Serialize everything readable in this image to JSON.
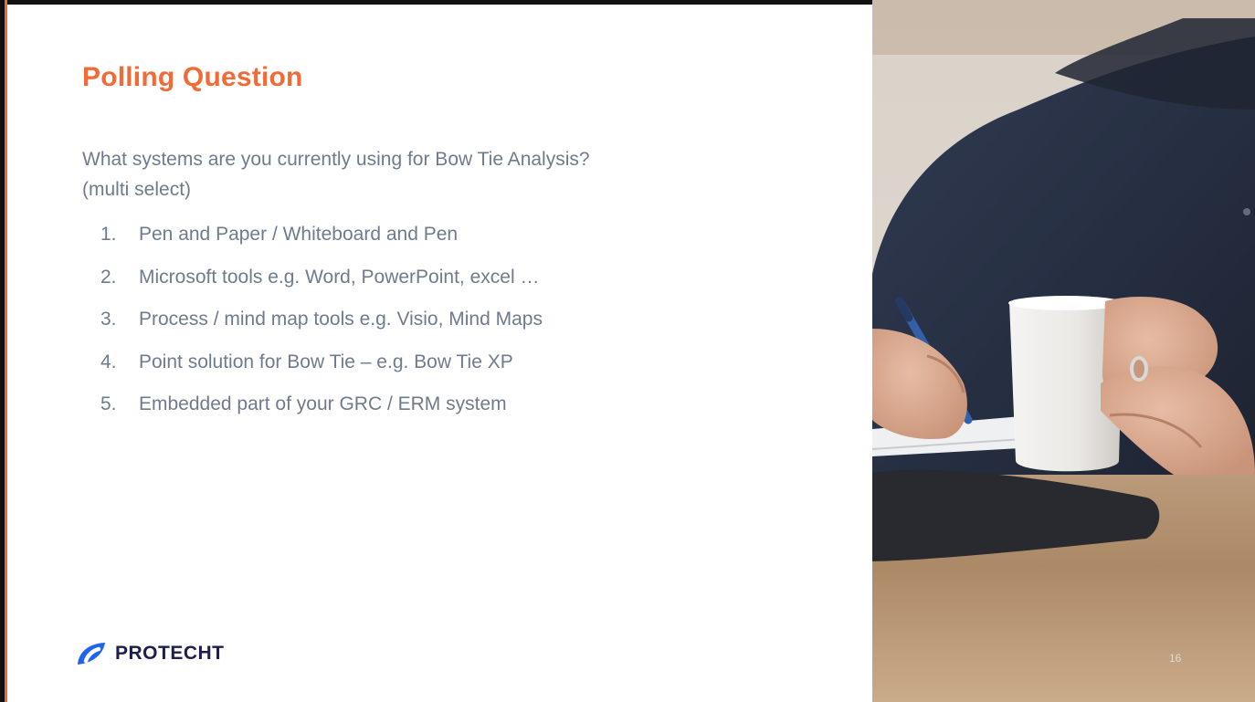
{
  "slide": {
    "title": "Polling Question",
    "question_line1": "What systems are you currently using for Bow Tie Analysis?",
    "question_line2": "(multi select)",
    "options": [
      {
        "num": "1.",
        "text": "Pen and Paper / Whiteboard and Pen"
      },
      {
        "num": "2.",
        "text": "Microsoft tools e.g. Word, PowerPoint, excel …"
      },
      {
        "num": "3.",
        "text": "Process / mind map tools e.g. Visio, Mind Maps"
      },
      {
        "num": "4.",
        "text": "Point solution for Bow Tie – e.g. Bow Tie XP"
      },
      {
        "num": "5.",
        "text": "Embedded part of your GRC / ERM system"
      }
    ],
    "logo_text": "PROTECHT",
    "page_number": "16",
    "photo_icon": "person-writing-with-coffee-photo"
  },
  "colors": {
    "accent": "#f26b36",
    "body_text": "#6f7b8d",
    "logo_text": "#1a1f4b",
    "logo_mark": "#1f63f2"
  }
}
